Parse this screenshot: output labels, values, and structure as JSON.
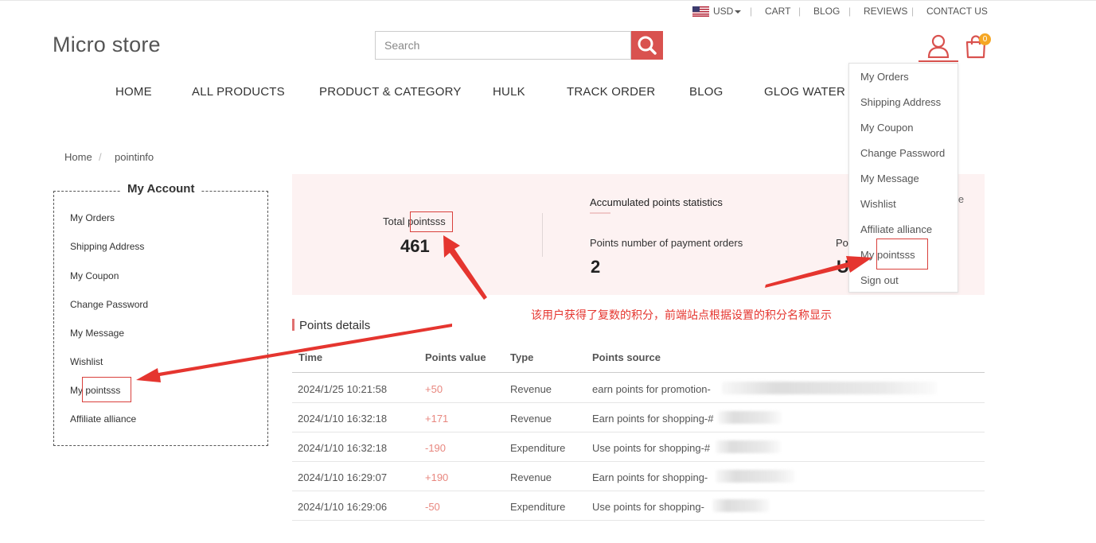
{
  "topbar": {
    "currency": "USD",
    "links": [
      "CART",
      "BLOG",
      "REVIEWS",
      "CONTACT US"
    ]
  },
  "header": {
    "logo": "Micro store",
    "search_placeholder": "Search",
    "cart_count": "0"
  },
  "nav": [
    "HOME",
    "ALL PRODUCTS",
    "PRODUCT & CATEGORY",
    "HULK",
    "TRACK ORDER",
    "BLOG",
    "GLOG WATER"
  ],
  "account_dropdown": {
    "items": [
      "My Orders",
      "Shipping Address",
      "My Coupon",
      "Change Password",
      "My Message",
      "Wishlist",
      "Affiliate alliance",
      "My",
      "Sign out"
    ],
    "points_word": "pointsss"
  },
  "breadcrumb": [
    "Home",
    "pointinfo"
  ],
  "sidebar": {
    "title": "My Account",
    "items": [
      "My Orders",
      "Shipping Address",
      "My Coupon",
      "Change Password",
      "My Message",
      "Wishlist",
      "My",
      "Affiliate alliance"
    ],
    "points_word": "pointsss"
  },
  "stats": {
    "total_prefix": "Total",
    "total_word": "pointsss",
    "total_value": "461",
    "accumulated_title": "Accumulated points statistics",
    "payment_orders_label": "Points number of payment orders",
    "payment_orders_value": "2",
    "partial_label": "Po",
    "partial_value": "U",
    "partial_right": "le"
  },
  "details": {
    "title": "Points details",
    "columns": [
      "Time",
      "Points value",
      "Type",
      "Points source"
    ],
    "rows": [
      {
        "time": "2024/1/25 10:21:58",
        "value": "+50",
        "type": "Revenue",
        "source": "earn points for promotion-"
      },
      {
        "time": "2024/1/10 16:32:18",
        "value": "+171",
        "type": "Revenue",
        "source": "Earn points for shopping-#"
      },
      {
        "time": "2024/1/10 16:32:18",
        "value": "-190",
        "type": "Expenditure",
        "source": "Use points for shopping-#"
      },
      {
        "time": "2024/1/10 16:29:07",
        "value": "+190",
        "type": "Revenue",
        "source": "Earn points for shopping-"
      },
      {
        "time": "2024/1/10 16:29:06",
        "value": "-50",
        "type": "Expenditure",
        "source": "Use points for shopping-"
      }
    ]
  },
  "annotation": {
    "text": "该用户获得了复数的积分，前端站点根据设置的积分名称显示",
    "color": "#e5352f"
  },
  "colors": {
    "accent": "#d9524f",
    "badge": "#f5a623",
    "stats_bg": "#fdf2f2",
    "points_value": "#e8877f"
  }
}
